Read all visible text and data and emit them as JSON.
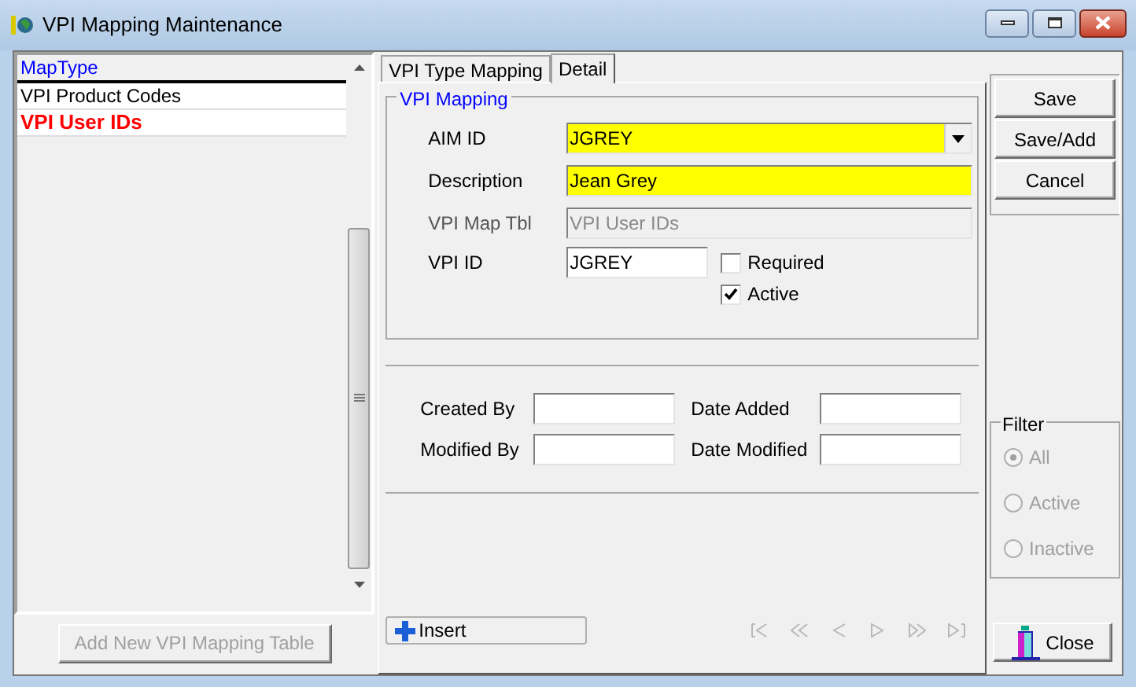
{
  "window": {
    "title": "VPI Mapping Maintenance"
  },
  "map_list": {
    "header": "MapType",
    "items": [
      {
        "label": "VPI Product Codes",
        "selected": false
      },
      {
        "label": "VPI User IDs",
        "selected": true
      }
    ]
  },
  "add_table_button": {
    "label": "Add New VPI Mapping Table",
    "disabled": true
  },
  "tabs": [
    {
      "label": "VPI Type Mapping",
      "selected": false
    },
    {
      "label": "Detail",
      "selected": true
    }
  ],
  "vpi_mapping": {
    "legend": "VPI Mapping",
    "fields": [
      {
        "label": "AIM ID",
        "value": "JGREY",
        "kind": "dropdown",
        "highlighted": true,
        "disabled": false
      },
      {
        "label": "Description",
        "value": "Jean Grey",
        "kind": "text",
        "highlighted": true,
        "disabled": false
      },
      {
        "label": "VPI Map Tbl",
        "value": "VPI User IDs",
        "kind": "text",
        "highlighted": false,
        "disabled": true
      }
    ],
    "vpi_id": {
      "label": "VPI ID",
      "value": "JGREY"
    },
    "checkboxes": [
      {
        "label": "Required",
        "checked": false
      },
      {
        "label": "Active",
        "checked": true
      }
    ]
  },
  "audit": [
    {
      "label": "Created By"
    },
    {
      "label": "Date Added"
    },
    {
      "label": "Modified By"
    },
    {
      "label": "Date Modified"
    }
  ],
  "insert_button": {
    "label": "Insert"
  },
  "actions": [
    "Save",
    "Save/Add",
    "Cancel"
  ],
  "filter": {
    "legend": "Filter",
    "disabled": true,
    "options": [
      {
        "label": "All",
        "selected": true
      },
      {
        "label": "Active",
        "selected": false
      },
      {
        "label": "Inactive",
        "selected": false
      }
    ]
  },
  "close_button": {
    "label": "Close"
  }
}
